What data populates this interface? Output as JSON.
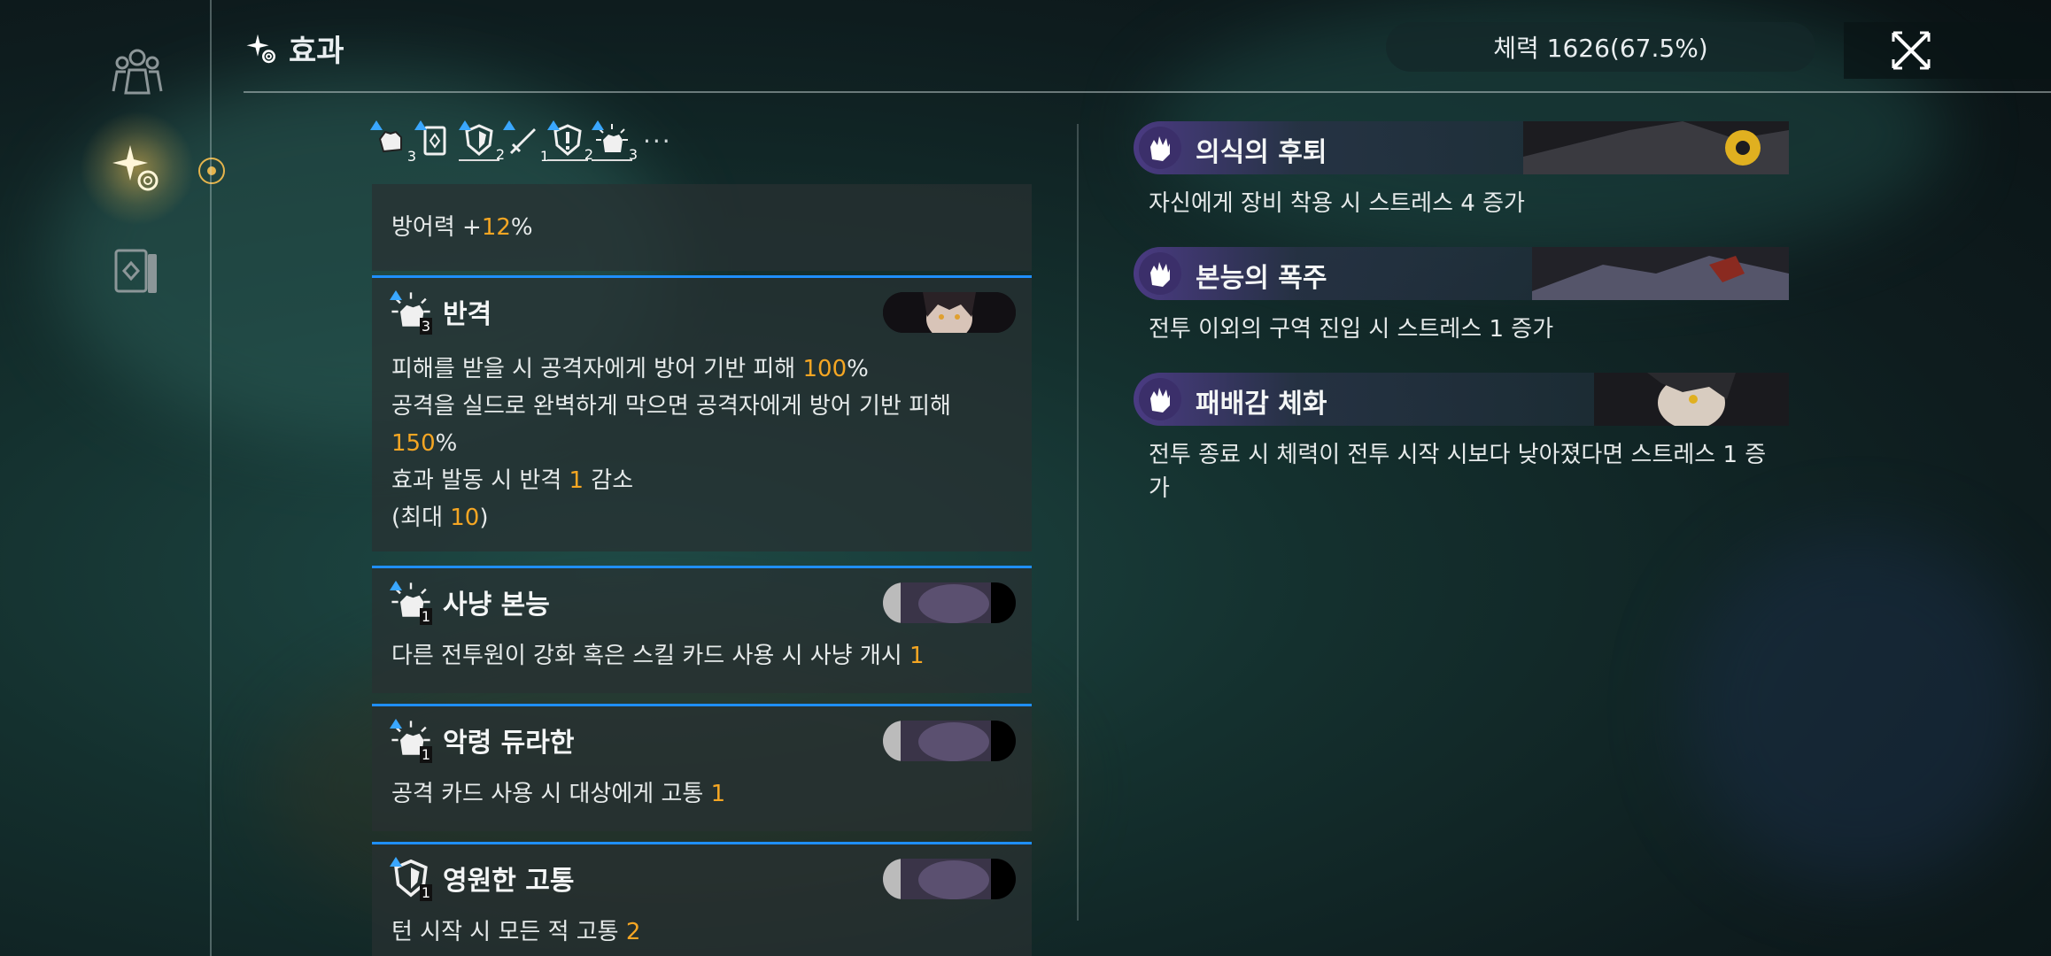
{
  "header": {
    "title": "효과",
    "hp_text": "체력 1626(67.5%)"
  },
  "tags": [
    {
      "num": "3",
      "underlined": false
    },
    {
      "num": "",
      "underlined": false
    },
    {
      "num": "2",
      "underlined": true
    },
    {
      "num": "1",
      "underlined": false
    },
    {
      "num": "2",
      "underlined": true
    },
    {
      "num": "3",
      "underlined": true
    }
  ],
  "tags_more": "···",
  "cards": {
    "c0": {
      "line1_pre": "방어력 +",
      "line1_val": "12",
      "line1_post": "%"
    },
    "c1": {
      "name": "반격",
      "num": "3",
      "l1_pre": "피해를 받을 시 공격자에게 방어 기반 피해 ",
      "l1_val": "100",
      "l1_post": "%",
      "l2": "공격을 실드로 완벽하게 막으면 공격자에게 방어 기반 피해",
      "l3_val": "150",
      "l3_post": "%",
      "l4_pre": "효과 발동 시 반격 ",
      "l4_val": "1",
      "l4_post": " 감소",
      "l5_pre": "(최대 ",
      "l5_val": "10",
      "l5_post": ")"
    },
    "c2": {
      "name": "사냥 본능",
      "num": "1",
      "l1_pre": "다른 전투원이 강화 혹은 스킬 카드 사용 시 사냥 개시 ",
      "l1_val": "1"
    },
    "c3": {
      "name": "악령 듀라한",
      "num": "1",
      "l1_pre": "공격 카드 사용 시 대상에게 고통 ",
      "l1_val": "1"
    },
    "c4": {
      "name": "영원한 고통",
      "num": "1",
      "l1_pre": "턴 시작 시 모든 적 고통 ",
      "l1_val": "2"
    }
  },
  "traits": [
    {
      "name": "의식의 후퇴",
      "desc": "자신에게 장비 착용 시 스트레스 4 증가"
    },
    {
      "name": "본능의 폭주",
      "desc": "전투 이외의 구역 진입 시 스트레스 1 증가"
    },
    {
      "name": "패배감 체화",
      "desc": "전투 종료 시 체력이 전투 시작 시보다 낮아졌다면 스트레스 1 증가"
    }
  ],
  "colors": {
    "accent": "#f5a623",
    "card_topline": "#1f8fff",
    "upgrade_arrow": "#3aa7ff",
    "rail_active": "#e6b44c"
  },
  "icons": {
    "rail": [
      "party-icon",
      "effects-sparkle-icon",
      "card-deck-icon"
    ],
    "close": "close-x-icon"
  }
}
